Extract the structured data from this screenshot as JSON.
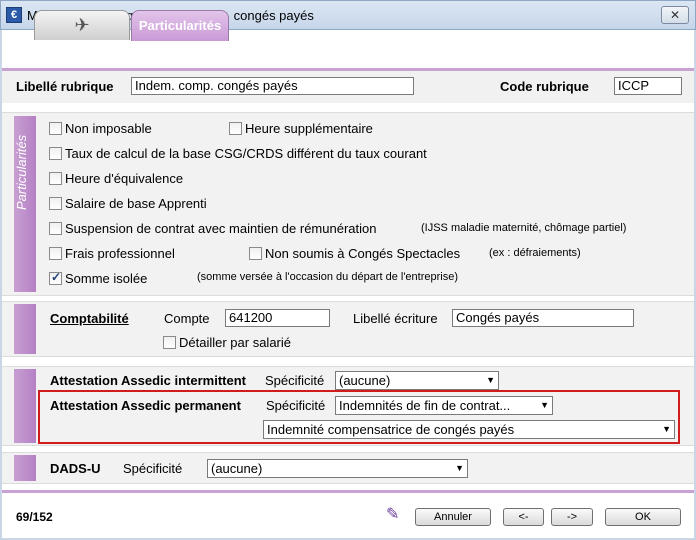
{
  "window": {
    "title": "Modification rubrique Indem. comp. congés payés",
    "close": "✕",
    "app_icon": "€"
  },
  "tabs": {
    "icon_tab_glyph": "✈",
    "active_tab": "Particularités"
  },
  "header": {
    "libelle_label": "Libellé rubrique",
    "libelle_value": "Indem. comp. congés payés",
    "code_label": "Code rubrique",
    "code_value": "ICCP"
  },
  "particularites": {
    "section_label": "Particularités",
    "items": [
      {
        "label": "Non imposable",
        "checked": false
      },
      {
        "label": "Heure supplémentaire",
        "checked": false
      },
      {
        "label": "Taux de calcul de la base CSG/CRDS différent du taux courant",
        "checked": false
      },
      {
        "label": "Heure d'équivalence",
        "checked": false
      },
      {
        "label": "Salaire de base Apprenti",
        "checked": false
      },
      {
        "label": "Suspension de contrat avec maintien de rémunération",
        "checked": false,
        "note": "(IJSS maladie maternité, chômage partiel)"
      },
      {
        "label": "Frais professionnel",
        "checked": false
      },
      {
        "label": "Non soumis à Congés Spectacles",
        "checked": false,
        "note": "(ex : défraiements)"
      },
      {
        "label": "Somme isolée",
        "checked": true,
        "note": "(somme versée à l'occasion du départ de l'entreprise)"
      }
    ]
  },
  "comptabilite": {
    "title": "Comptabilité",
    "compte_label": "Compte",
    "compte_value": "641200",
    "libelle_ecriture_label": "Libellé écriture",
    "libelle_ecriture_value": "Congés payés",
    "detail_label": "Détailler par salarié",
    "detail_checked": false
  },
  "assedic": {
    "intermittent_label": "Attestation Assedic intermittent",
    "intermittent_spec_label": "Spécificité",
    "intermittent_value": "(aucune)",
    "permanent_label": "Attestation Assedic permanent",
    "permanent_spec_label": "Spécificité",
    "permanent_value": "Indemnités de fin de contrat...",
    "permanent_detail_value": "Indemnité compensatrice de congés payés"
  },
  "dadsu": {
    "label": "DADS-U",
    "spec_label": "Spécificité",
    "value": "(aucune)"
  },
  "footer": {
    "count": "69/152",
    "cancel": "Annuler",
    "prev": "<-",
    "next": "->",
    "ok": "OK"
  }
}
